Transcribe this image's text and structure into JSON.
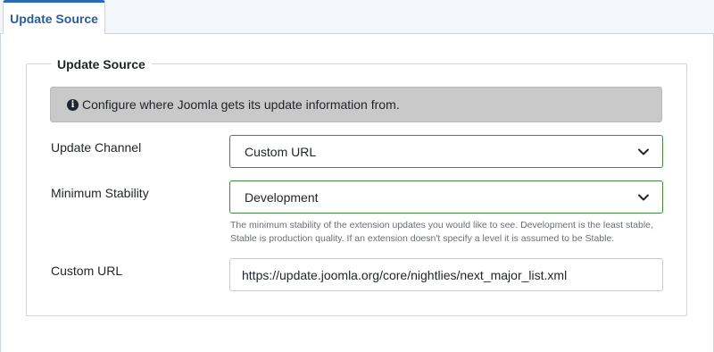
{
  "tabs": [
    {
      "label": "Update Source"
    }
  ],
  "fieldset": {
    "legend": "Update Source"
  },
  "alert": {
    "icon": "info-icon",
    "text": "Configure where Joomla gets its update information from."
  },
  "fields": {
    "update_channel": {
      "label": "Update Channel",
      "value": "Custom URL"
    },
    "minimum_stability": {
      "label": "Minimum Stability",
      "value": "Development",
      "description": "The minimum stability of the extension updates you would like to see. Development is the least stable, Stable is production quality. If an extension doesn't specify a level it is assumed to be Stable."
    },
    "custom_url": {
      "label": "Custom URL",
      "value": "https://update.joomla.org/core/nightlies/next_major_list.xml"
    }
  },
  "colors": {
    "tab_accent": "#2a69b8",
    "select_border": "#3f8a3f",
    "alert_background": "#c9c9c9"
  }
}
